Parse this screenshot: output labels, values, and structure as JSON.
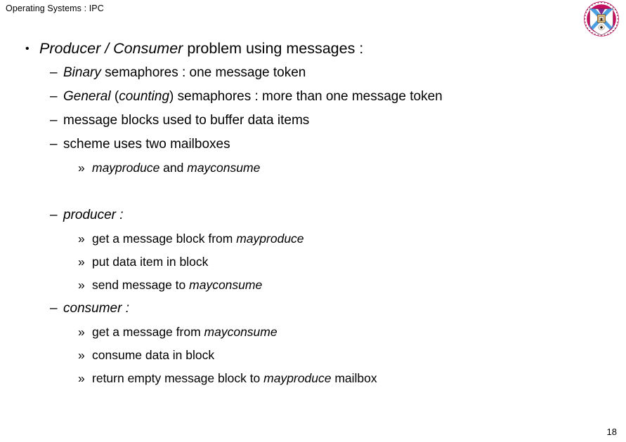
{
  "header": {
    "title": "Operating Systems : IPC"
  },
  "logo": {
    "name": "university-of-edinburgh-crest",
    "ring_text": "THE UNIVERSITY OF EDINBURGH",
    "colors": {
      "ring": "#C4105C",
      "saltire": "#4C9FE0",
      "field": "#FFFFFF",
      "emblem": "#D8B77A",
      "outline": "#7A0A38"
    }
  },
  "content": {
    "lines": [
      {
        "level": 1,
        "marker": "•",
        "name": "bullet-producer-consumer",
        "parts": [
          {
            "text": "Producer / Consumer ",
            "italic": true
          },
          {
            "text": "problem using messages :",
            "italic": false
          }
        ]
      },
      {
        "level": 2,
        "marker": "–",
        "name": "bullet-binary-semaphores",
        "parts": [
          {
            "text": "Binary ",
            "italic": true
          },
          {
            "text": "semaphores : one message token",
            "italic": false
          }
        ]
      },
      {
        "level": 2,
        "marker": "–",
        "name": "bullet-general-semaphores",
        "parts": [
          {
            "text": "General ",
            "italic": true
          },
          {
            "text": "(",
            "italic": false
          },
          {
            "text": "counting",
            "italic": true
          },
          {
            "text": ") semaphores : more than one message token",
            "italic": false
          }
        ]
      },
      {
        "level": 2,
        "marker": "–",
        "name": "bullet-message-blocks",
        "parts": [
          {
            "text": "message blocks used to buffer data items",
            "italic": false
          }
        ]
      },
      {
        "level": 2,
        "marker": "–",
        "name": "bullet-two-mailboxes",
        "parts": [
          {
            "text": "scheme uses two mailboxes",
            "italic": false
          }
        ]
      },
      {
        "level": 3,
        "marker": "»",
        "name": "bullet-mailbox-names",
        "parts": [
          {
            "text": "mayproduce",
            "italic": true
          },
          {
            "text": "  and  ",
            "italic": false
          },
          {
            "text": "mayconsume",
            "italic": true
          }
        ]
      },
      {
        "level": 0,
        "marker": "",
        "name": "blank-spacer",
        "parts": []
      },
      {
        "level": 2,
        "marker": "–",
        "name": "bullet-producer-heading",
        "parts": [
          {
            "text": "producer :",
            "italic": true
          }
        ]
      },
      {
        "level": 3,
        "marker": "»",
        "name": "bullet-producer-get-block",
        "parts": [
          {
            "text": "get a message block from ",
            "italic": false
          },
          {
            "text": "mayproduce",
            "italic": true
          }
        ]
      },
      {
        "level": 3,
        "marker": "»",
        "name": "bullet-producer-put-data",
        "parts": [
          {
            "text": "put data item in block",
            "italic": false
          }
        ]
      },
      {
        "level": 3,
        "marker": "»",
        "name": "bullet-producer-send-message",
        "parts": [
          {
            "text": "send message to ",
            "italic": false
          },
          {
            "text": "mayconsume",
            "italic": true
          }
        ]
      },
      {
        "level": 2,
        "marker": "–",
        "name": "bullet-consumer-heading",
        "parts": [
          {
            "text": "consumer :",
            "italic": true
          }
        ]
      },
      {
        "level": 3,
        "marker": "»",
        "name": "bullet-consumer-get-message",
        "parts": [
          {
            "text": "get a message from ",
            "italic": false
          },
          {
            "text": "mayconsume",
            "italic": true
          }
        ]
      },
      {
        "level": 3,
        "marker": "»",
        "name": "bullet-consumer-consume-data",
        "parts": [
          {
            "text": "consume data in block",
            "italic": false
          }
        ]
      },
      {
        "level": 3,
        "marker": "»",
        "name": "bullet-consumer-return-block",
        "parts": [
          {
            "text": "return empty message block to ",
            "italic": false
          },
          {
            "text": "mayproduce",
            "italic": true
          },
          {
            "text": " mailbox",
            "italic": false
          }
        ]
      }
    ]
  },
  "footer": {
    "page_number": "18"
  }
}
